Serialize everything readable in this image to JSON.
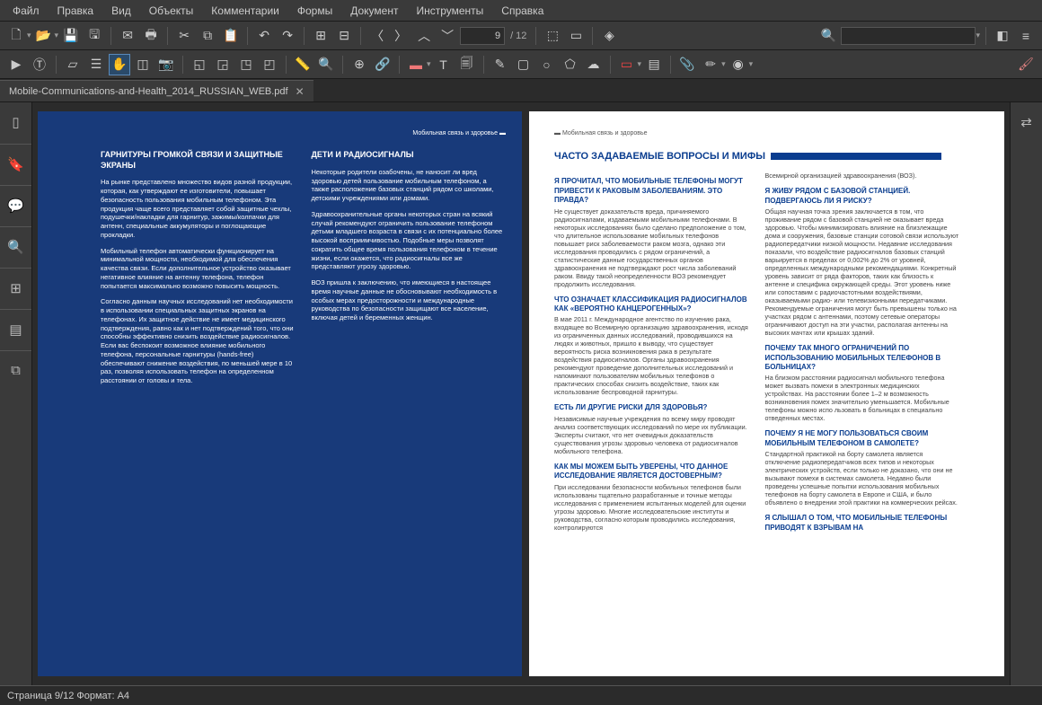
{
  "menu": {
    "file": "Файл",
    "edit": "Правка",
    "view": "Вид",
    "objects": "Объекты",
    "comments": "Комментарии",
    "forms": "Формы",
    "document": "Документ",
    "tools": "Инструменты",
    "help": "Справка"
  },
  "toolbar": {
    "page_current": "9",
    "page_total": "/ 12"
  },
  "tab": {
    "title": "Mobile-Communications-and-Health_2014_RUSSIAN_WEB.pdf"
  },
  "status": {
    "text": "Страница 9/12 Формат: A4"
  },
  "docL": {
    "hdr": "Мобильная связь и здоровье",
    "h1": "ГАРНИТУРЫ ГРОМКОЙ СВЯЗИ И ЗАЩИТНЫЕ ЭКРАНЫ",
    "p1": "На рынке представлено множество видов разной продукции, которая, как утверждают ее изготовители, повышает безопасность пользования мобильным телефоном. Эта продукция чаще всего представляет собой защитные чехлы, подушечки/накладки для гарнитур, зажимы/колпачки для антенн, специальные аккумуляторы и поглощающие прокладки.",
    "p2": "Мобильный телефон автоматически функционирует на минимальной мощности, необходимой для обеспечения качества связи. Если дополнительное устройство оказывает негативное влияние на антенну телефона, телефон попытается максимально возможно повысить мощность.",
    "p3": "Согласно данным научных исследований нет необходимости в использовании специальных защитных экранов на телефонах. Их защитное действие не имеет медицинского подтверждения, равно как и нет подтверждений того, что они способны эффективно снизить воздействие радиосигналов. Если вас беспокоит возможное влияние мобильного телефона, персональные гарнитуры (hands-free) обеспечивают снижение воздействия, по меньшей мере в 10 раз, позволяя использовать телефон на определенном расстоянии от головы и тела.",
    "h2": "ДЕТИ И РАДИОСИГНАЛЫ",
    "p4": "Некоторые родители озабочены, не наносит ли вред здоровью детей пользование мобильным телефоном, а также расположение базовых станций рядом со школами, детскими учреждениями или домами.",
    "p5": "Здравоохранительные органы некоторых стран на всякий случай рекомендуют ограничить пользование телефоном детьми младшего возраста в связи с их потенциально более высокой восприимчивостью. Подобные меры позволят сократить общее время пользования телефоном в течение жизни, если окажется, что радиосигналы все же представляют угрозу здоровью.",
    "p6": "ВОЗ пришла к заключению, что имеющиеся в настоящее время научные данные не обосновывают необходимость в особых мерах предосторожности и международные руководства по безопасности защищают все население, включая детей и беременных женщин."
  },
  "docR": {
    "hdr": "Мобильная связь и здоровье",
    "faq": "ЧАСТО ЗАДАВАЕМЫЕ ВОПРОСЫ И МИФЫ",
    "q1": "Я ПРОЧИТАЛ, ЧТО МОБИЛЬНЫЕ ТЕЛЕФОНЫ МОГУТ ПРИВЕСТИ К РАКОВЫМ ЗАБОЛЕВАНИЯМ. ЭТО ПРАВДА?",
    "a1": "Не существует доказательств вреда, причиняемого радиосигналами, издаваемыми мобильными телефонами. В некоторых исследованиях было сделано предположение о том, что длительное использование мобильных телефонов повышает риск заболеваемости раком мозга, однако эти исследования проводились с рядом ограничений, а статистические данные государственных органов здравоохранения не подтверждают рост числа заболеваний раком. Ввиду такой неопределенности ВОЗ рекомендует продолжить исследования.",
    "q2": "ЧТО ОЗНАЧАЕТ КЛАССИФИКАЦИЯ РАДИОСИГНАЛОВ КАК «ВЕРОЯТНО КАНЦЕРОГЕННЫХ»?",
    "a2": "В мае 2011 г. Международное агентство по изучению рака, входящее во Всемирную организацию здравоохранения, исходя из ограниченных данных исследований, проводившихся на людях и животных, пришло к выводу, что существует вероятность риска возникновения рака в результате воздействия радиосигналов. Органы здравоохранения рекомендуют проведение дополнительных исследований и напоминают пользователям мобильных телефонов о практических способах снизить воздействие, таких как использование беспроводной гарнитуры.",
    "q3": "ЕСТЬ ЛИ ДРУГИЕ РИСКИ ДЛЯ ЗДОРОВЬЯ?",
    "a3": "Независимые научные учреждения по всему миру проводят анализ соответствующих исследований по мере их публикации. Эксперты считают, что нет очевидных доказательств существования угрозы здоровью человека от радиосигналов мобильного телефона.",
    "q4": "КАК МЫ МОЖЕМ БЫТЬ УВЕРЕНЫ, ЧТО ДАННОЕ ИССЛЕДОВАНИЕ ЯВЛЯЕТСЯ ДОСТОВЕРНЫМ?",
    "a4": "При исследовании безопасности мобильных телефонов были использованы тщательно разработанные и точные методы исследования с применением испытанных моделей для оценки угрозы здоровью. Многие исследовательские институты и руководства, согласно которым проводились исследования, контролируются",
    "a4b": "Всемирной организацией здравоохранения (ВОЗ).",
    "q5": "Я ЖИВУ РЯДОМ С БАЗОВОЙ СТАНЦИЕЙ. ПОДВЕРГАЮСЬ ЛИ Я РИСКУ?",
    "a5": "Общая научная точка зрения заключается в том, что проживание рядом с базовой станцией не оказывает вреда здоровью. Чтобы минимизировать влияние на близлежащие дома и сооружения, базовые станции сотовой связи используют радиопередатчики низкой мощности. Недавние исследования показали, что воздействие радиосигналов базовых станций варьируется в пределах от 0,002% до 2% от уровней, определенных международными рекомендациями. Конкретный уровень зависит от ряда факторов, таких как близость к антенне и специфика окружающей среды. Этот уровень ниже или сопоставим с радиочастотными воздействиями, оказываемыми радио- или телевизионными передатчиками. Рекомендуемые ограничения могут быть превышены только на участках рядом с антеннами, поэтому сетевые операторы ограничивают доступ на эти участки, располагая антенны на высоких мачтах или крышах зданий.",
    "q6": "ПОЧЕМУ ТАК МНОГО ОГРАНИЧЕНИЙ ПО ИСПОЛЬЗОВАНИЮ МОБИЛЬНЫХ ТЕЛЕФОНОВ В БОЛЬНИЦАХ?",
    "a6": "На близком расстоянии радиосигнал мобильного телефона может вызвать помехи в электронных медицинских устройствах. На расстоянии более 1–2 м возможность возникновения помех значительно уменьшается. Мобильные телефоны можно испо льзовать в больницах в специально отведенных местах.",
    "q7": "ПОЧЕМУ Я НЕ МОГУ ПОЛЬЗОВАТЬСЯ СВОИМ МОБИЛЬНЫМ ТЕЛЕФОНОМ В САМОЛЕТЕ?",
    "a7": "Стандартной практикой на борту самолета является отключение радиопередатчиков всех типов и некоторых электрических устройств, если только не доказано, что они не вызывают помехи в системах самолета. Недавно были проведены успешные попытки использования мобильных телефонов на борту самолета в Европе и США, и было объявлено о внедрении этой практики на коммерческих рейсах.",
    "q8": "Я СЛЫШАЛ О ТОМ, ЧТО МОБИЛЬНЫЕ ТЕЛЕФОНЫ ПРИВОДЯТ К ВЗРЫВАМ НА"
  }
}
